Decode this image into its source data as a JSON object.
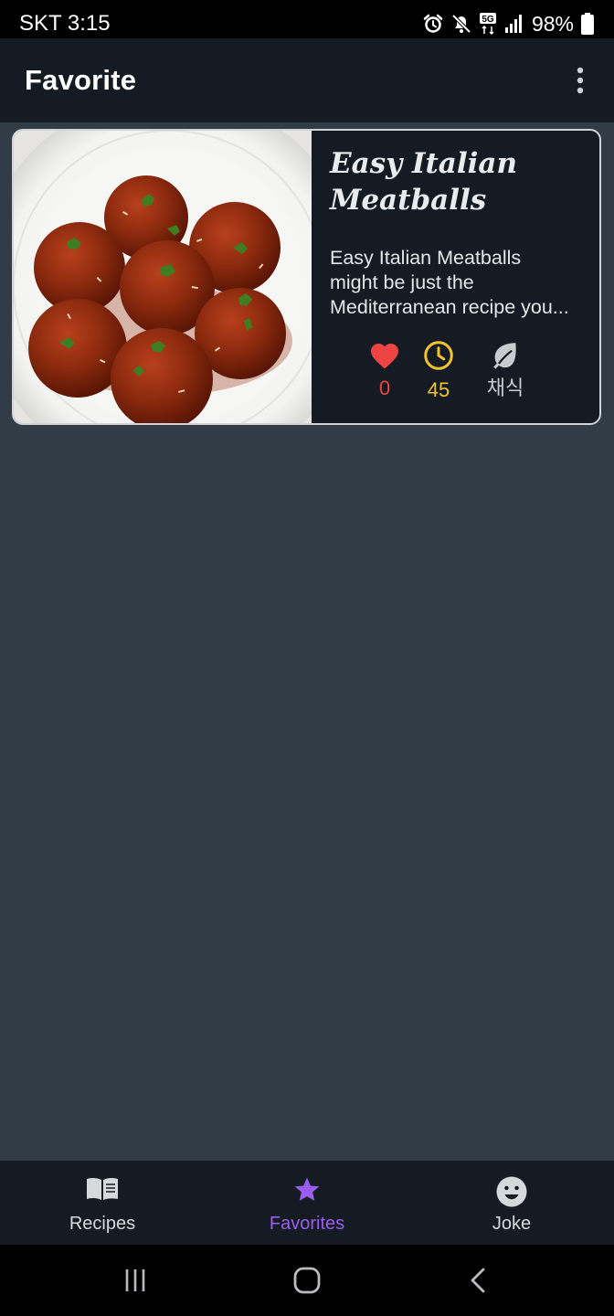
{
  "status_bar": {
    "carrier_time": "SKT 3:15",
    "network": "5G",
    "battery": "98%"
  },
  "app_bar": {
    "title": "Favorite",
    "menu_icon": "more-vert-icon"
  },
  "recipes": [
    {
      "title": "Easy Italian Meatballs",
      "description_lines": [
        "Easy Italian Meatballs",
        "might be just the",
        "Mediterranean recipe you..."
      ],
      "likes": "0",
      "minutes": "45",
      "vegan_label": "채식",
      "colors": {
        "likes": "#ef4444",
        "time": "#f3c22d",
        "vegan": "#c9cccf"
      }
    }
  ],
  "bottom_nav": {
    "items": [
      {
        "label": "Recipes",
        "icon": "book-icon",
        "selected": false
      },
      {
        "label": "Favorites",
        "icon": "star-icon",
        "selected": true
      },
      {
        "label": "Joke",
        "icon": "smiley-icon",
        "selected": false
      }
    ],
    "accent": "#9b5cf0"
  },
  "system_nav": [
    "recent-apps-icon",
    "home-icon",
    "back-icon"
  ]
}
